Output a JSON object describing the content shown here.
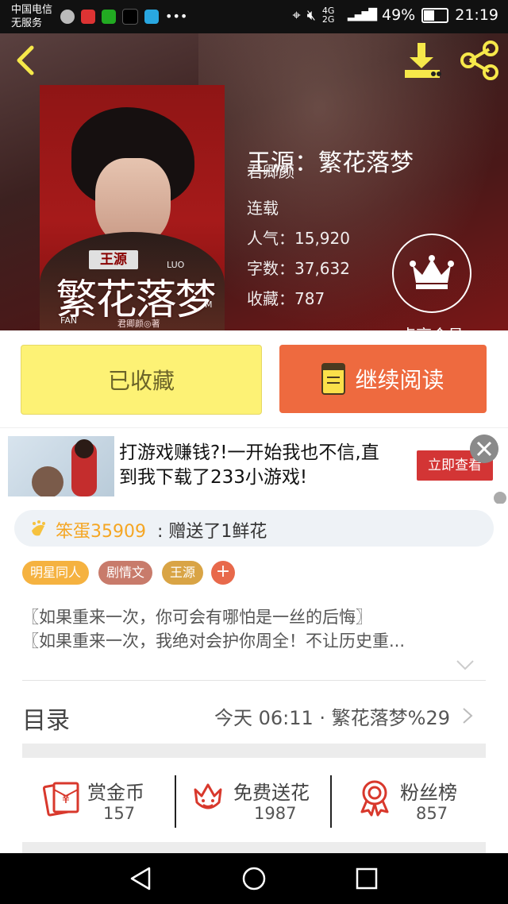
{
  "status": {
    "carrier_line1": "中国电信",
    "carrier_line2": "无服务",
    "network": "4G 2G",
    "battery": "49%",
    "time": "21:19"
  },
  "header": {
    "book_title": "王源：繁花落梦",
    "author": "君卿颜",
    "serial_status": "连载",
    "popularity_label": "人气：15,920",
    "word_count_label": "字数：37,632",
    "favorites_label": "收藏：787",
    "vip_label": "点亮会员"
  },
  "cover": {
    "badge": "王源",
    "big_title": "繁花落梦",
    "sub": "LUO",
    "fan": "FAN",
    "author_credit": "君卿颜◎著",
    "m": "M"
  },
  "actions": {
    "favorited_label": "已收藏",
    "continue_label": "继续阅读"
  },
  "ad": {
    "text": "打游戏赚钱?!一开始我也不信,直到我下载了233小游戏!",
    "cta": "立即查看"
  },
  "gift": {
    "user": "笨蛋35909",
    "message": ": 赠送了1鲜花"
  },
  "tags": [
    "明星同人",
    "剧情文",
    "王源"
  ],
  "tag_colors": [
    "#f5b240",
    "#c87b6b",
    "#d9a445"
  ],
  "tag_add": "+",
  "description": [
    "〖如果重来一次，你可会有哪怕是一丝的后悔〗",
    "〖如果重来一次，我绝对会护你周全！不让历史重..."
  ],
  "toc": {
    "title": "目录",
    "latest": "今天 06:11 · 繁花落梦%29"
  },
  "stats": [
    {
      "label": "赏金币",
      "value": "157",
      "icon": "red-envelope-icon"
    },
    {
      "label": "免费送花",
      "value": "1987",
      "icon": "flower-icon"
    },
    {
      "label": "粉丝榜",
      "value": "857",
      "icon": "medal-icon"
    }
  ],
  "colors": {
    "accent_orange": "#ee6a3f",
    "fav_yellow": "#fdf275",
    "stat_red": "#d8382c"
  }
}
